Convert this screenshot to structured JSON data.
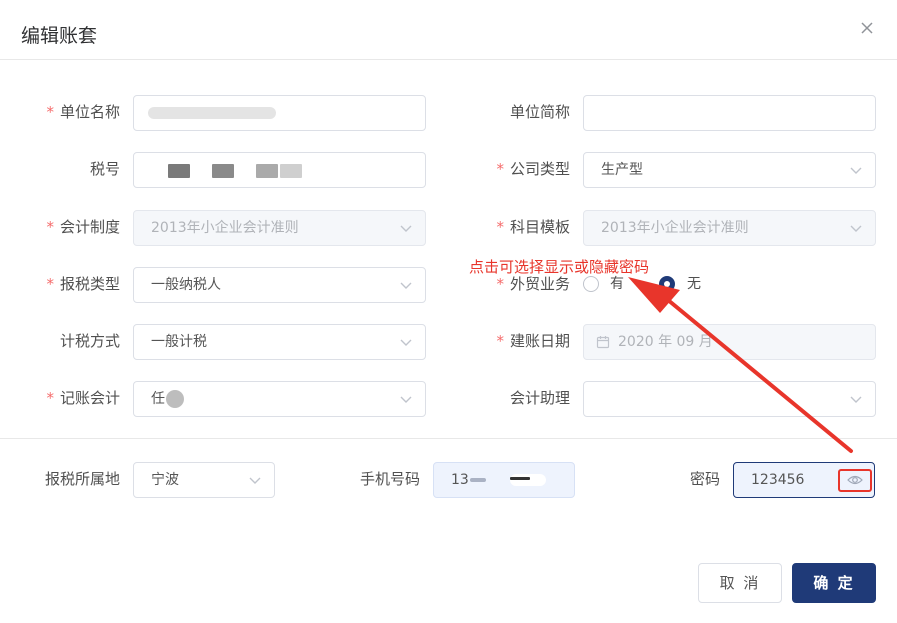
{
  "dialog": {
    "title": "编辑账套"
  },
  "form": {
    "unit_name_label": "单位名称",
    "unit_short_label": "单位简称",
    "unit_short_value": "",
    "tax_no_label": "税号",
    "company_type_label": "公司类型",
    "company_type_value": "生产型",
    "accounting_system_label": "会计制度",
    "accounting_system_value": "2013年小企业会计准则",
    "subject_template_label": "科目模板",
    "subject_template_value": "2013年小企业会计准则",
    "tax_type_label": "报税类型",
    "tax_type_value": "一般纳税人",
    "foreign_trade_label": "外贸业务",
    "foreign_trade_options": [
      "有",
      "无"
    ],
    "foreign_trade_selected": "无",
    "tax_method_label": "计税方式",
    "tax_method_value": "一般计税",
    "founding_date_label": "建账日期",
    "founding_date_value": "2020 年 09 月",
    "accountant_label": "记账会计",
    "accountant_value": "任",
    "assistant_label": "会计助理",
    "assistant_value": "",
    "tax_location_label": "报税所属地",
    "tax_location_value": "宁波",
    "phone_label": "手机号码",
    "phone_value": "13",
    "password_label": "密码",
    "password_value": "123456"
  },
  "annotation": {
    "text": "点击可选择显示或隐藏密码"
  },
  "buttons": {
    "cancel": "取 消",
    "confirm": "确 定"
  },
  "colors": {
    "primary": "#1f3a78",
    "required": "#f56c6c",
    "annotation": "#e8352b"
  },
  "icons": [
    "close-icon",
    "chevron-down-icon",
    "calendar-icon",
    "eye-icon"
  ]
}
